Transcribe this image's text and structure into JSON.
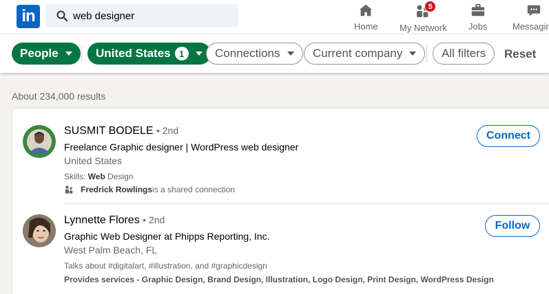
{
  "nav": {
    "logo_text": "in",
    "search_value": "web designer",
    "items": [
      {
        "label": "Home",
        "icon": "home-icon"
      },
      {
        "label": "My Network",
        "icon": "network-icon",
        "badge": "5"
      },
      {
        "label": "Jobs",
        "icon": "briefcase-icon"
      },
      {
        "label": "Messaging",
        "icon": "messaging-icon"
      }
    ]
  },
  "filters": {
    "people": "People",
    "location": "United States",
    "location_count": "1",
    "connections": "Connections",
    "current_company": "Current company",
    "all_filters": "All filters",
    "reset": "Reset"
  },
  "results": {
    "count_text": "About 234,000 results",
    "items": [
      {
        "name": "SUSMIT BODELE",
        "degree": "• 2nd",
        "headline": "Freelance Graphic designer | WordPress web designer",
        "location": "United States",
        "skills_prefix": "Skills: ",
        "skills_bold": "Web",
        "skills_rest": " Design",
        "shared_name": "Fredrick Rowlings",
        "shared_rest": " is a shared connection",
        "action": "Connect"
      },
      {
        "name": "Lynnette Flores",
        "degree": "• 2nd",
        "headline": "Graphic Web Designer at Phipps Reporting, Inc.",
        "location": "West Palm Beach, FL",
        "talks": "Talks about #digitalart, #illustration, and #graphicdesign",
        "services": "Provides services - Graphic Design, Brand Design, Illustration, Logo Design, Print Design, WordPress Design",
        "action": "Follow"
      }
    ]
  },
  "colors": {
    "brand": "#0a66c2",
    "green": "#057642",
    "badge": "#cc1016"
  }
}
